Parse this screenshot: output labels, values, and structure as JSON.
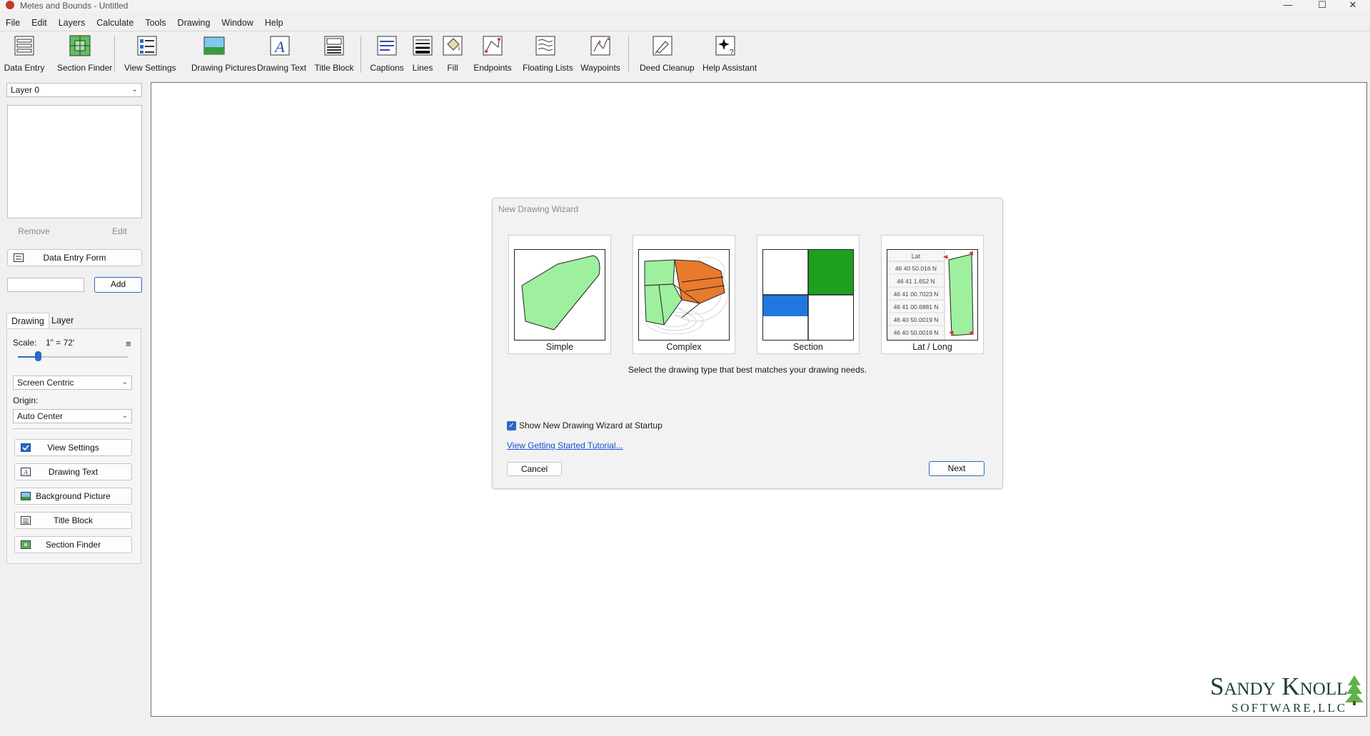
{
  "window": {
    "title": "Metes and Bounds - Untitled",
    "controls": {
      "minimize": "—",
      "maximize": "☐",
      "close": "✕"
    }
  },
  "menu": [
    "File",
    "Edit",
    "Layers",
    "Calculate",
    "Tools",
    "Drawing",
    "Window",
    "Help"
  ],
  "toolbar": [
    {
      "label": "Data Entry",
      "icon": "data-entry-icon"
    },
    {
      "label": "Section Finder",
      "icon": "section-finder-icon"
    },
    {
      "label": "View Settings",
      "icon": "view-settings-icon"
    },
    {
      "label": "Drawing Pictures",
      "icon": "drawing-pictures-icon"
    },
    {
      "label": "Drawing Text",
      "icon": "drawing-text-icon"
    },
    {
      "label": "Title Block",
      "icon": "title-block-icon"
    },
    {
      "label": "Captions",
      "icon": "captions-icon"
    },
    {
      "label": "Lines",
      "icon": "lines-icon"
    },
    {
      "label": "Fill",
      "icon": "fill-icon"
    },
    {
      "label": "Endpoints",
      "icon": "endpoints-icon"
    },
    {
      "label": "Floating Lists",
      "icon": "floating-lists-icon"
    },
    {
      "label": "Waypoints",
      "icon": "waypoints-icon"
    },
    {
      "label": "Deed Cleanup",
      "icon": "deed-cleanup-icon"
    },
    {
      "label": "Help Assistant",
      "icon": "help-assistant-icon"
    }
  ],
  "sidebar": {
    "layer_select": "Layer 0",
    "remove_label": "Remove",
    "edit_label": "Edit",
    "data_entry_form_label": "Data Entry Form",
    "add_input_value": "",
    "add_label": "Add",
    "tabs": [
      "Drawing",
      "Layer"
    ],
    "scale_label": "Scale:",
    "scale_value": "1\" = 72'",
    "scale_slider_fraction": 0.18,
    "centric_select": "Screen Centric",
    "origin_label": "Origin:",
    "origin_select": "Auto Center",
    "buttons": [
      "View Settings",
      "Drawing Text",
      "Background Picture",
      "Title Block",
      "Section Finder"
    ]
  },
  "wizard": {
    "title": "New Drawing Wizard",
    "options": [
      "Simple",
      "Complex",
      "Section",
      "Lat / Long"
    ],
    "latlong_header": "Lat",
    "latlong_rows": [
      "46 40 50.016 N",
      "46 41 1.652 N",
      "46 41 00.7023 N",
      "46 41 00.6881 N",
      "46 40 50.0019 N",
      "46 40 50.0019 N"
    ],
    "instruction": "Select the drawing type that best matches your drawing needs.",
    "show_at_startup_label": "Show New Drawing Wizard at Startup",
    "show_at_startup_checked": true,
    "tutorial_link": "View Getting Started Tutorial...",
    "cancel_label": "Cancel",
    "next_label": "Next"
  },
  "logo": {
    "line1": "Sandy Knoll",
    "line2": "SOFTWARE,LLC"
  },
  "colors": {
    "accent": "#2b69c4",
    "parcel_green": "#9eef9e",
    "section_green": "#1ea01e",
    "section_blue": "#1e78e0",
    "complex_orange": "#e87a2c",
    "link": "#1a4fd6"
  }
}
